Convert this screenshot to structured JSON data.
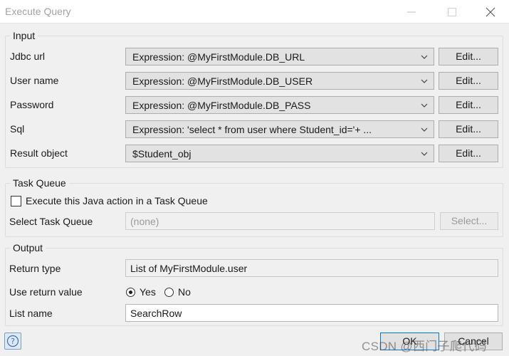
{
  "window": {
    "title": "Execute Query"
  },
  "input_group": {
    "legend": "Input",
    "rows": [
      {
        "label": "Jdbc url",
        "value": "Expression: @MyFirstModule.DB_URL",
        "button": "Edit..."
      },
      {
        "label": "User name",
        "value": "Expression: @MyFirstModule.DB_USER",
        "button": "Edit..."
      },
      {
        "label": "Password",
        "value": "Expression: @MyFirstModule.DB_PASS",
        "button": "Edit..."
      },
      {
        "label": "Sql",
        "value": "Expression: 'select * from user where Student_id='+ ...",
        "button": "Edit..."
      },
      {
        "label": "Result object",
        "value": "$Student_obj",
        "button": "Edit..."
      }
    ]
  },
  "task_queue_group": {
    "legend": "Task Queue",
    "checkbox_label": "Execute this Java action in a Task Queue",
    "checkbox_checked": false,
    "select_label": "Select Task Queue",
    "select_value": "(none)",
    "select_button": "Select..."
  },
  "output_group": {
    "legend": "Output",
    "return_type_label": "Return type",
    "return_type_value": "List of MyFirstModule.user",
    "use_return_label": "Use return value",
    "yes_label": "Yes",
    "no_label": "No",
    "selected": "Yes",
    "list_name_label": "List name",
    "list_name_value": "SearchRow"
  },
  "footer": {
    "ok_label": "OK",
    "cancel_label": "Cancel",
    "watermark": "CSDN @西门子爬代码"
  },
  "colors": {
    "title_text": "#a3a3a3",
    "ok_border": "#0078d7",
    "field_bg": "#e2e2e2"
  },
  "icons": {
    "help": "help-icon",
    "minimize": "minimize-icon",
    "maximize": "maximize-icon",
    "close": "close-icon",
    "dropdown": "chevron-down-icon"
  }
}
